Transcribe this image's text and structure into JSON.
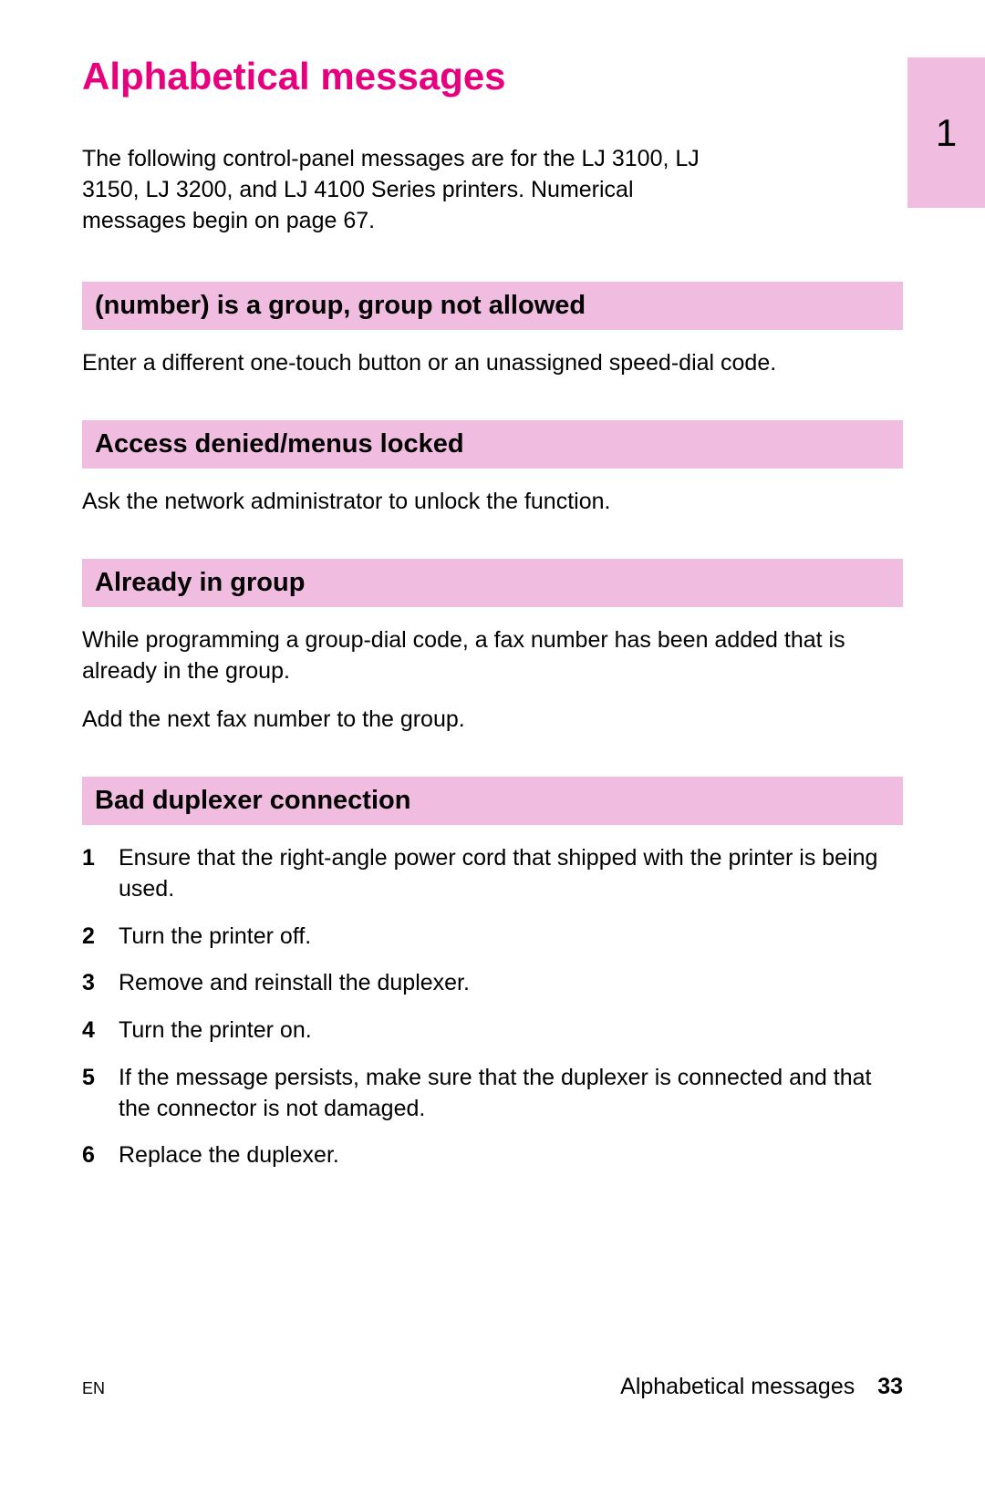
{
  "chapterTab": "1",
  "title": "Alphabetical messages",
  "intro": "The following control-panel messages are for the LJ 3100, LJ 3150, LJ 3200, and LJ 4100 Series printers. Numerical messages begin on page 67.",
  "sections": [
    {
      "header": "(number) is a group, group not allowed",
      "paragraphs": [
        "Enter a different one-touch button or an unassigned speed-dial code."
      ]
    },
    {
      "header": "Access denied/menus locked",
      "paragraphs": [
        "Ask the network administrator to unlock the function."
      ]
    },
    {
      "header": "Already in group",
      "paragraphs": [
        "While programming a group-dial code, a fax number has been added that is already in the group.",
        "Add the next fax number to the group."
      ]
    },
    {
      "header": "Bad duplexer connection",
      "orderedList": [
        "Ensure that the right-angle power cord that shipped with the printer is being used.",
        "Turn the printer off.",
        "Remove and reinstall the duplexer.",
        "Turn the printer on.",
        "If the message persists, make sure that the duplexer is connected and that the connector is not damaged.",
        "Replace the duplexer."
      ]
    }
  ],
  "footer": {
    "left": "EN",
    "rightLabel": "Alphabetical messages",
    "pageNumber": "33"
  }
}
